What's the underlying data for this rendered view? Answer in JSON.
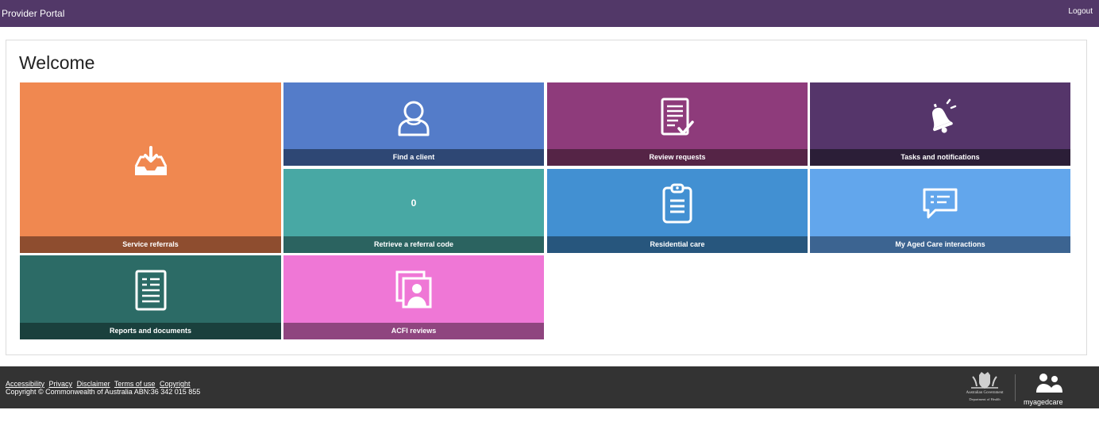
{
  "header": {
    "title": "Provider Portal",
    "logout_label": "Logout"
  },
  "main": {
    "heading": "Welcome"
  },
  "tiles": {
    "service_referrals": {
      "label": "Service referrals",
      "icon": "inbox-download-icon",
      "color": "#f08850",
      "bar_color": "#8e4d2f"
    },
    "find_client": {
      "label": "Find a client",
      "icon": "person-icon",
      "color": "#547cc9",
      "bar_color": "#2e4774"
    },
    "review_requests": {
      "label": "Review requests",
      "icon": "document-check-icon",
      "color": "#8e3b7b",
      "bar_color": "#552446"
    },
    "tasks_notifications": {
      "label": "Tasks and notifications",
      "icon": "bell-icon",
      "color": "#55356a",
      "bar_color": "#2b1e37"
    },
    "retrieve_referral": {
      "label": "Retrieve a referral code",
      "count": "0",
      "color": "#48a8a4",
      "bar_color": "#2b6360"
    },
    "residential_care": {
      "label": "Residential care",
      "icon": "clipboard-icon",
      "color": "#4290d2",
      "bar_color": "#27567d"
    },
    "my_aged_care_interactions": {
      "label": "My Aged Care interactions",
      "icon": "chat-bubble-icon",
      "color": "#62a6ec",
      "bar_color": "#3c6491"
    },
    "reports_documents": {
      "label": "Reports and documents",
      "icon": "document-list-icon",
      "color": "#2c6b66",
      "bar_color": "#1a403d"
    },
    "acfi_reviews": {
      "label": "ACFI reviews",
      "icon": "photo-person-icon",
      "color": "#ef77d6",
      "bar_color": "#8f457f"
    }
  },
  "footer": {
    "links": [
      "Accessibility",
      "Privacy",
      "Disclaimer",
      "Terms of use",
      "Copyright"
    ],
    "copyright": "Copyright © Commonwealth of Australia ABN:36 342 015 855",
    "gov_logo_line1": "Australian Government",
    "gov_logo_line2": "Department of Health",
    "mac_logo_text": "myagedcare"
  }
}
